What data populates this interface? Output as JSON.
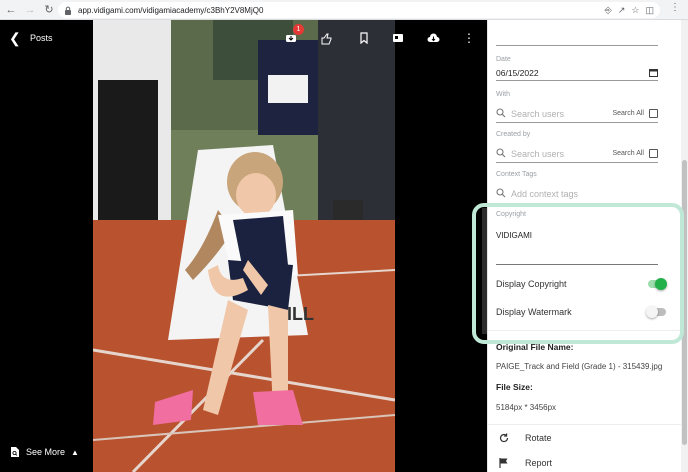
{
  "browser": {
    "url": "app.vidigami.com/vidigamiacademy/c3BhY2V8MjQ0"
  },
  "viewer": {
    "back_label": "Posts",
    "notification_count": "1",
    "see_more_label": "See More"
  },
  "panel": {
    "date": {
      "label": "Date",
      "value": "06/15/2022"
    },
    "with": {
      "label": "With",
      "placeholder": "Search users",
      "search_all": "Search All"
    },
    "created_by": {
      "label": "Created by",
      "placeholder": "Search users",
      "search_all": "Search All"
    },
    "context_tags": {
      "label": "Context Tags",
      "placeholder": "Add context tags"
    },
    "copyright": {
      "label": "Copyright",
      "value": "VIDIGAMI"
    },
    "display_copyright": {
      "label": "Display Copyright",
      "on": true
    },
    "display_watermark": {
      "label": "Display Watermark",
      "on": false
    },
    "original_file_name": {
      "label": "Original File Name:",
      "value": "PAIGE_Track and Field (Grade 1) - 315439.jpg"
    },
    "file_size": {
      "label": "File Size:",
      "value": "5184px * 3456px"
    },
    "actions": [
      {
        "label": "Rotate"
      },
      {
        "label": "Report"
      }
    ]
  },
  "colors": {
    "toggle_on": "#22b04b",
    "highlight": "#bfe8d6"
  }
}
